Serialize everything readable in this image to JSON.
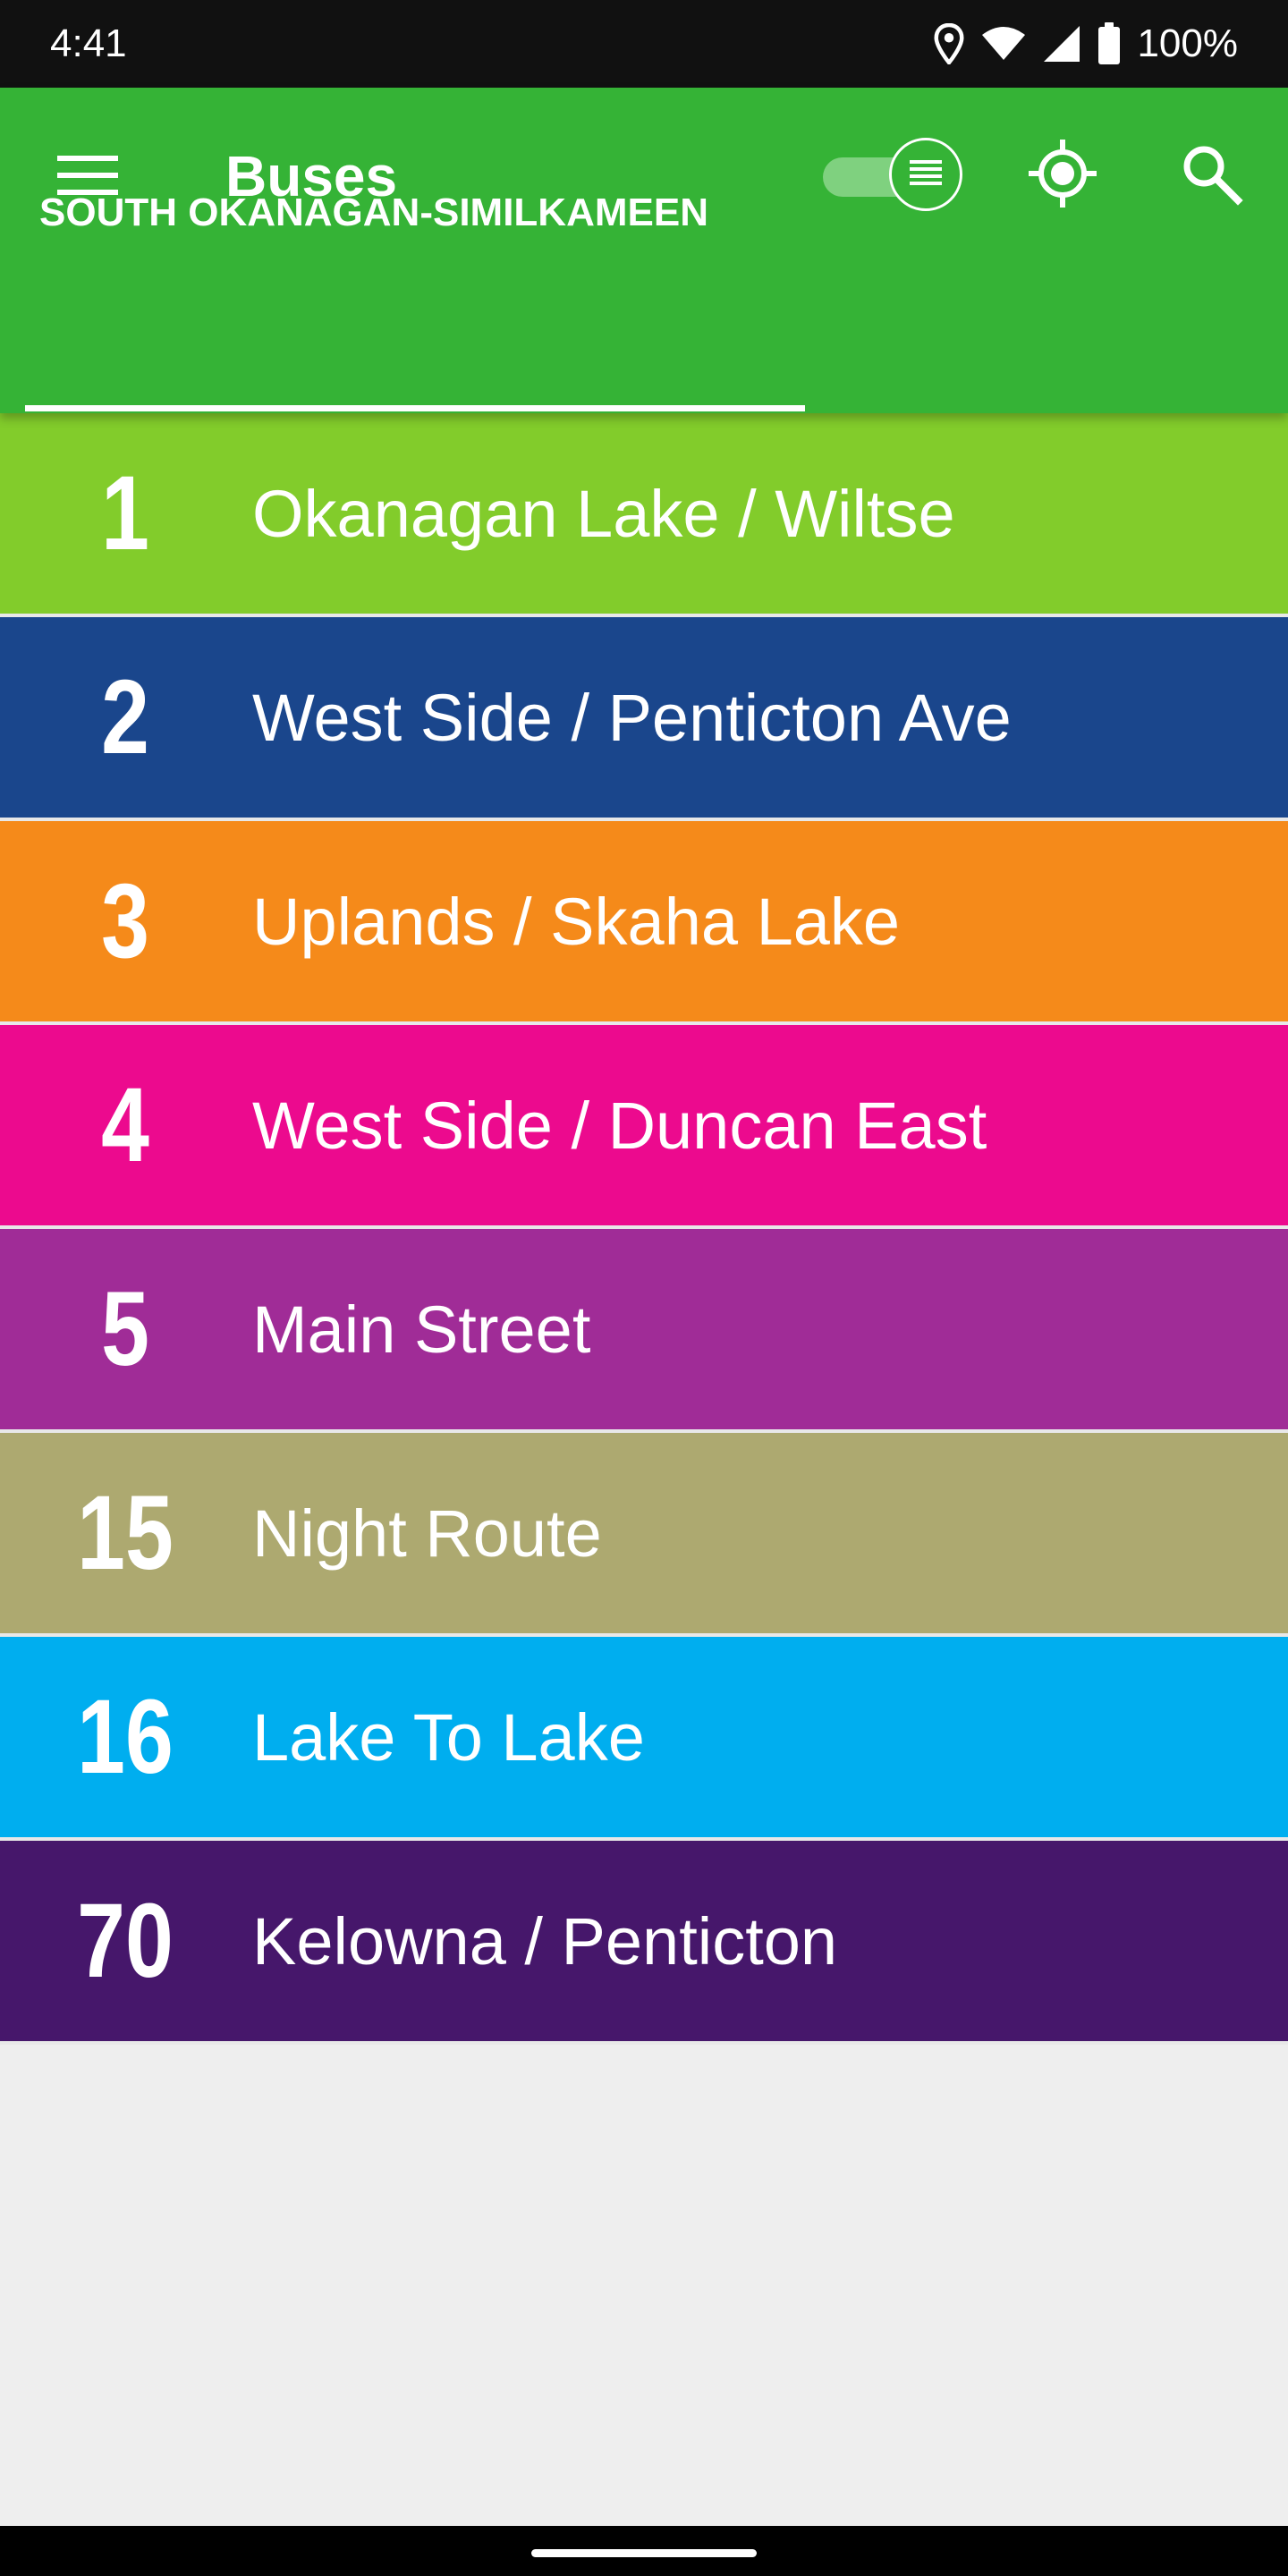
{
  "status_bar": {
    "time": "4:41",
    "battery": "100%",
    "icons": [
      "location-icon",
      "wifi-icon",
      "signal-icon",
      "battery-icon"
    ]
  },
  "app_bar": {
    "title": "Buses",
    "background_color": "#35b336",
    "actions": [
      "menu-icon",
      "list-map-toggle",
      "my-location-icon",
      "search-icon"
    ]
  },
  "tabs": [
    {
      "label": "SOUTH OKANAGAN-SIMILKAMEEN",
      "selected": true
    }
  ],
  "routes": [
    {
      "number": "1",
      "name": "Okanagan Lake / Wiltse",
      "color": "#82cc2b"
    },
    {
      "number": "2",
      "name": "West Side / Penticton Ave",
      "color": "#1a468c"
    },
    {
      "number": "3",
      "name": "Uplands / Skaha Lake",
      "color": "#f58a1a"
    },
    {
      "number": "4",
      "name": "West Side / Duncan East",
      "color": "#ec0a8e"
    },
    {
      "number": "5",
      "name": "Main Street",
      "color": "#a02c97"
    },
    {
      "number": "15",
      "name": "Night Route",
      "color": "#ada970"
    },
    {
      "number": "16",
      "name": "Lake To Lake",
      "color": "#00aeef"
    },
    {
      "number": "70",
      "name": "Kelowna / Penticton",
      "color": "#46176b"
    }
  ]
}
